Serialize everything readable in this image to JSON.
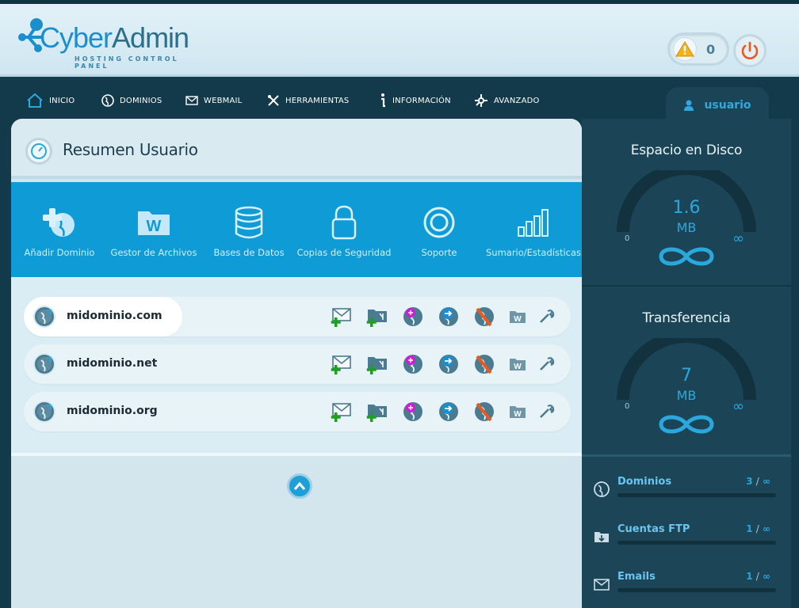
{
  "header": {
    "brand_part1": "Cyber",
    "brand_part2": "Admin",
    "tagline": "HOSTING CONTROL PANEL",
    "alert_count": "0"
  },
  "nav": {
    "items": [
      {
        "label": "INICIO",
        "icon": "home-icon"
      },
      {
        "label": "DOMINIOS",
        "icon": "globe-icon"
      },
      {
        "label": "WEBMAIL",
        "icon": "mail-icon"
      },
      {
        "label": "HERRAMIENTAS",
        "icon": "tools-icon"
      },
      {
        "label": "INFORMACIÓN",
        "icon": "info-icon"
      },
      {
        "label": "AVANZADO",
        "icon": "advanced-icon"
      }
    ],
    "user_label": "usuario"
  },
  "main": {
    "title": "Resumen Usuario",
    "quick_actions": [
      {
        "label": "Añadir Dominio",
        "icon": "add-domain-icon"
      },
      {
        "label": "Gestor de Archivos",
        "icon": "file-manager-icon"
      },
      {
        "label": "Bases de Datos",
        "icon": "database-icon"
      },
      {
        "label": "Copias de Seguridad",
        "icon": "backup-lock-icon"
      },
      {
        "label": "Soporte",
        "icon": "lifebuoy-icon"
      },
      {
        "label": "Sumario/Estadísticas",
        "icon": "stats-bars-icon"
      }
    ],
    "domains": [
      {
        "name": "midominio.com"
      },
      {
        "name": "midominio.net"
      },
      {
        "name": "midominio.org"
      }
    ]
  },
  "sidebar": {
    "disk": {
      "title": "Espacio en Disco",
      "value": "1.6",
      "unit": "MB",
      "min": "0",
      "max": "∞"
    },
    "transfer": {
      "title": "Transferencia",
      "value": "7",
      "unit": "MB",
      "min": "0",
      "max": "∞"
    },
    "stats": [
      {
        "name": "Dominios",
        "used": "3",
        "limit": "∞",
        "icon": "globe-icon"
      },
      {
        "name": "Cuentas FTP",
        "used": "1",
        "limit": "∞",
        "icon": "ftp-folder-icon"
      },
      {
        "name": "Emails",
        "used": "1",
        "limit": "∞",
        "icon": "mail-icon"
      }
    ]
  },
  "colors": {
    "accent": "#0e9bd6",
    "sidebar_bg": "#1b4556",
    "nav_bg": "#123a4a"
  }
}
